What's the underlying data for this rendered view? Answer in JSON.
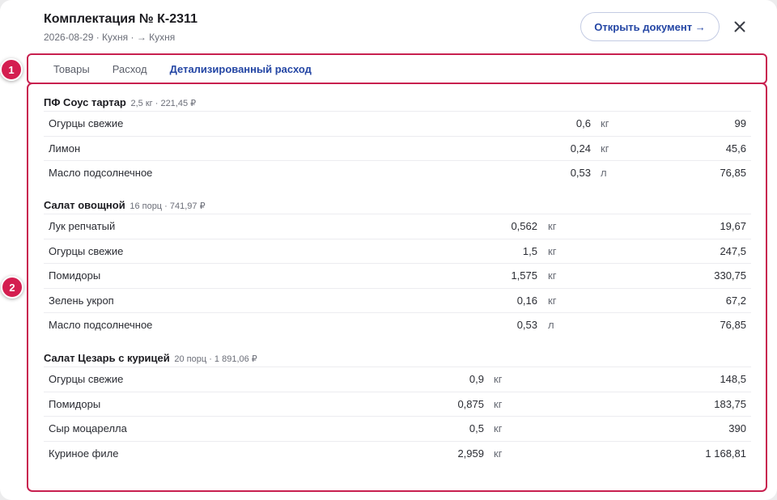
{
  "header": {
    "title": "Комплектация № К-2311",
    "subtitle": "2026-08-29 · Кухня · → Кухня",
    "open_button": "Открыть документ →"
  },
  "tabs": [
    {
      "label": "Товары",
      "active": false
    },
    {
      "label": "Расход",
      "active": false
    },
    {
      "label": "Детализированный расход",
      "active": true
    }
  ],
  "badges": [
    "1",
    "2"
  ],
  "groups": [
    {
      "name": "ПФ Соус тартар",
      "meta": "2,5 кг · 221,45 ₽",
      "rows": [
        {
          "name": "Огурцы свежие",
          "qty": "0,6",
          "unit": "кг",
          "sum": "99"
        },
        {
          "name": "Лимон",
          "qty": "0,24",
          "unit": "кг",
          "sum": "45,6"
        },
        {
          "name": "Масло подсолнечное",
          "qty": "0,53",
          "unit": "л",
          "sum": "76,85"
        }
      ]
    },
    {
      "name": "Салат овощной",
      "meta": "16 порц · 741,97 ₽",
      "rows": [
        {
          "name": "Лук репчатый",
          "qty": "0,562",
          "unit": "кг",
          "sum": "19,67"
        },
        {
          "name": "Огурцы свежие",
          "qty": "1,5",
          "unit": "кг",
          "sum": "247,5"
        },
        {
          "name": "Помидоры",
          "qty": "1,575",
          "unit": "кг",
          "sum": "330,75"
        },
        {
          "name": "Зелень укроп",
          "qty": "0,16",
          "unit": "кг",
          "sum": "67,2"
        },
        {
          "name": "Масло подсолнечное",
          "qty": "0,53",
          "unit": "л",
          "sum": "76,85"
        }
      ]
    },
    {
      "name": "Салат Цезарь с курицей",
      "meta": "20 порц · 1 891,06 ₽",
      "rows": [
        {
          "name": "Огурцы свежие",
          "qty": "0,9",
          "unit": "кг",
          "sum": "148,5"
        },
        {
          "name": "Помидоры",
          "qty": "0,875",
          "unit": "кг",
          "sum": "183,75"
        },
        {
          "name": "Сыр моцарелла",
          "qty": "0,5",
          "unit": "кг",
          "sum": "390"
        },
        {
          "name": "Куриное филе",
          "qty": "2,959",
          "unit": "кг",
          "sum": "1 168,81"
        }
      ]
    }
  ],
  "colors": {
    "accent": "#2446a4",
    "highlight": "#c8204f"
  }
}
